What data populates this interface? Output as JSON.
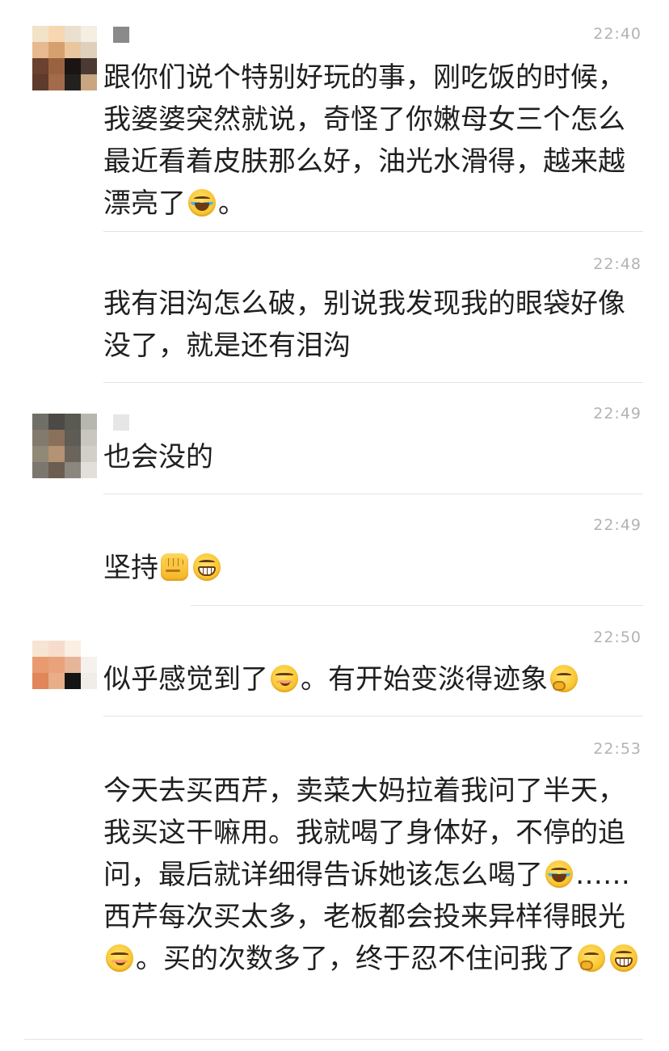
{
  "messages": [
    {
      "id": "msg-1",
      "time": "22:40",
      "segments": [
        {
          "type": "text",
          "value": "跟你们说个特别好玩的事，刚吃饭的时候，我婆婆突然就说，奇怪了你嫩母女三个怎么最近看着皮肤那么好，油光水滑得，越来越漂亮了"
        },
        {
          "type": "emoji",
          "name": "laugh-tears-icon"
        },
        {
          "type": "text",
          "value": "。"
        }
      ]
    },
    {
      "id": "msg-2",
      "time": "22:48",
      "segments": [
        {
          "type": "text",
          "value": "我有泪沟怎么破，别说我发现我的眼袋好像没了，就是还有泪沟"
        }
      ]
    },
    {
      "id": "msg-3",
      "time": "22:49",
      "segments": [
        {
          "type": "text",
          "value": "也会没的"
        }
      ]
    },
    {
      "id": "msg-4",
      "time": "22:49",
      "segments": [
        {
          "type": "text",
          "value": "坚持"
        },
        {
          "type": "emoji",
          "name": "fist-icon"
        },
        {
          "type": "emoji",
          "name": "grin-icon"
        }
      ]
    },
    {
      "id": "msg-5",
      "time": "22:50",
      "segments": [
        {
          "type": "text",
          "value": "似乎感觉到了"
        },
        {
          "type": "emoji",
          "name": "smirk-icon"
        },
        {
          "type": "text",
          "value": "。有开始变淡得迹象"
        },
        {
          "type": "emoji",
          "name": "thinking-icon"
        }
      ]
    },
    {
      "id": "msg-6",
      "time": "22:53",
      "segments": [
        {
          "type": "text",
          "value": "今天去买西芹，卖菜大妈拉着我问了半天，我买这干嘛用。我就喝了身体好，不停的追问，最后就详细得告诉她该怎么喝了"
        },
        {
          "type": "emoji",
          "name": "laugh-tears-icon"
        },
        {
          "type": "text",
          "value": "……西芹每次买太多，老板都会投来异样得眼光"
        },
        {
          "type": "emoji",
          "name": "smirk-icon"
        },
        {
          "type": "text",
          "value": "。买的次数多了，终于忍不住问我了"
        },
        {
          "type": "emoji",
          "name": "thinking-icon"
        },
        {
          "type": "emoji",
          "name": "grin-icon"
        }
      ]
    }
  ],
  "colors": {
    "text": "#1f1f1f",
    "time": "#b3b3b3",
    "divider": "#e3e3e3"
  }
}
